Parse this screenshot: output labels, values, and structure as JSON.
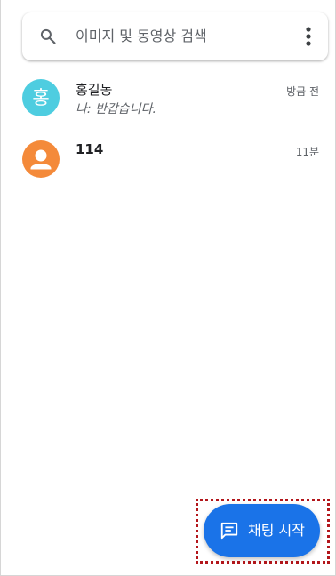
{
  "search": {
    "placeholder": "이미지 및 동영상 검색",
    "search_icon": "search-icon",
    "menu_icon": "more-vert-icon"
  },
  "conversations": [
    {
      "avatar_letter": "홍",
      "avatar_color": "#4ecde0",
      "name": "홍길동",
      "snippet": "나: 반갑습니다.",
      "time": "방금 전"
    },
    {
      "avatar_icon": "person-icon",
      "avatar_color": "#f48a3a",
      "name": "114",
      "time": "11분"
    }
  ],
  "fab": {
    "label": "채팅 시작",
    "icon": "message-icon",
    "color": "#1a73e8",
    "highlight_color": "#b3161b"
  }
}
